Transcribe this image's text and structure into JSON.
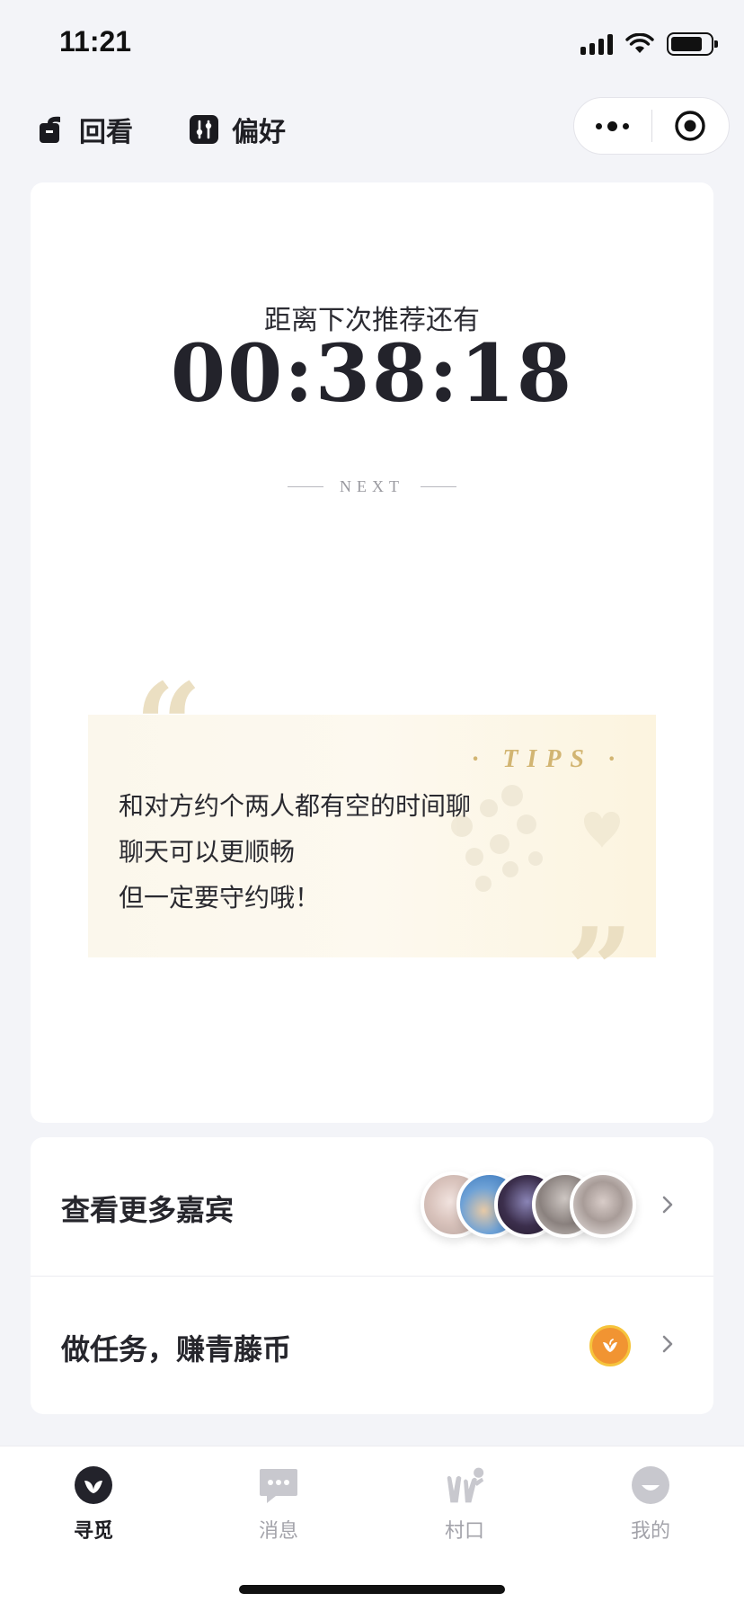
{
  "status_bar": {
    "time": "11:21"
  },
  "top_nav": {
    "replay_label": "回看",
    "prefs_label": "偏好"
  },
  "countdown": {
    "label": "距离下次推荐还有",
    "time": "00:38:18",
    "next_text": "NEXT"
  },
  "tips": {
    "title": "· TIPS ·",
    "lines": [
      "和对方约个两人都有空的时间聊",
      "聊天可以更顺畅",
      "但一定要守约哦！"
    ],
    "quote_open": "“",
    "quote_close": "”"
  },
  "actions": {
    "more_guests_label": "查看更多嘉宾",
    "tasks_label": "做任务，赚青藤币"
  },
  "tabs": [
    {
      "label": "寻觅",
      "icon": "leaf-icon",
      "active": true
    },
    {
      "label": "消息",
      "icon": "chat-icon",
      "active": false
    },
    {
      "label": "村口",
      "icon": "village-icon",
      "active": false
    },
    {
      "label": "我的",
      "icon": "profile-icon",
      "active": false
    }
  ],
  "colors": {
    "background": "#f3f4f8",
    "tips_gold": "#d2b572",
    "coin_orange": "#f19432",
    "tab_active": "#1f1f24",
    "tab_inactive": "#c6c6cc"
  }
}
